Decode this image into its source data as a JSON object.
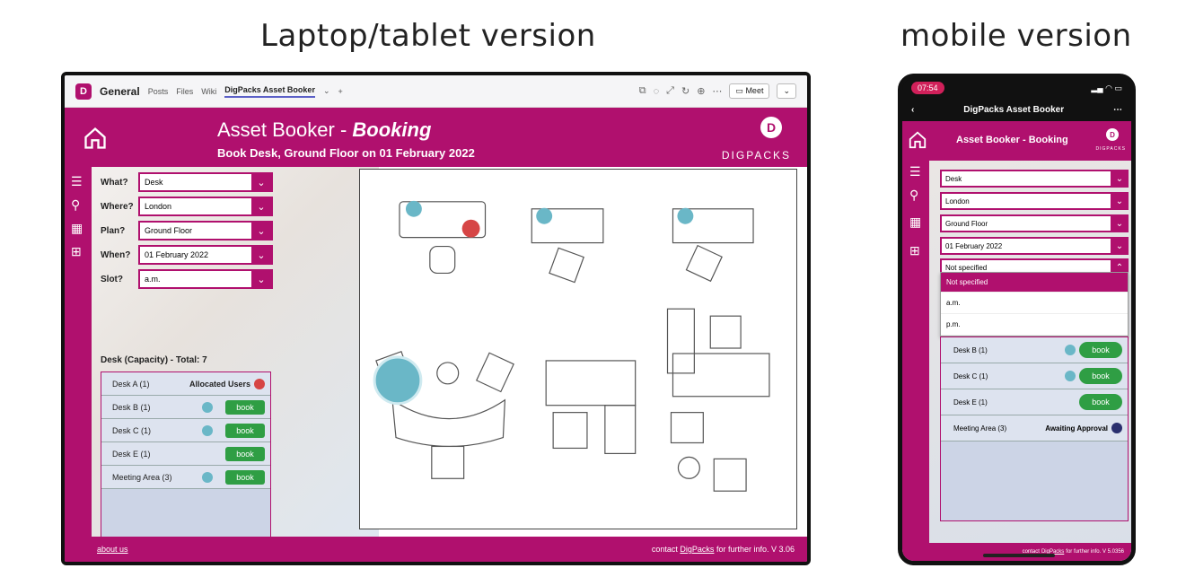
{
  "headings": {
    "laptop": "Laptop/tablet version",
    "mobile": "mobile version"
  },
  "teams": {
    "channel": "General",
    "tabs": [
      "Posts",
      "Files",
      "Wiki",
      "DigPacks Asset Booker"
    ],
    "meet_label": "Meet"
  },
  "app": {
    "title_main": "Asset Booker - ",
    "title_em": "Booking",
    "subtitle": "Book Desk, Ground Floor on 01 February 2022",
    "logo_text": "DIGPACKS",
    "filters": [
      {
        "label": "What?",
        "value": "Desk"
      },
      {
        "label": "Where?",
        "value": "London"
      },
      {
        "label": "Plan?",
        "value": "Ground Floor"
      },
      {
        "label": "When?",
        "value": "01 February 2022"
      },
      {
        "label": "Slot?",
        "value": "a.m."
      }
    ],
    "total_line": "Desk (Capacity) - Total: 7",
    "desks": [
      {
        "name": "Desk A (1)",
        "status": "Allocated Users"
      },
      {
        "name": "Desk B (1)",
        "action": "book"
      },
      {
        "name": "Desk C (1)",
        "action": "book"
      },
      {
        "name": "Desk E (1)",
        "action": "book"
      },
      {
        "name": "Meeting Area (3)",
        "action": "book"
      }
    ],
    "footer": {
      "about": "about us",
      "contact_pre": "contact ",
      "contact_link": "DigPacks",
      "contact_post": " for further info. V 3.06"
    }
  },
  "mobile": {
    "time": "07:54",
    "nav_title": "DigPacks Asset Booker",
    "app_title": "Asset Booker - Booking",
    "logo_text": "DIGPACKS",
    "filters": [
      "Desk",
      "London",
      "Ground Floor",
      "01 February 2022",
      "Not specified"
    ],
    "dropdown_options": [
      "Not specified",
      "a.m.",
      "p.m."
    ],
    "desks": [
      {
        "name": "Desk B (1)",
        "action": "book"
      },
      {
        "name": "Desk C (1)",
        "action": "book"
      },
      {
        "name": "Desk E (1)",
        "action": "book"
      },
      {
        "name": "Meeting Area (3)",
        "status": "Awaiting Approval"
      }
    ],
    "footer": {
      "contact_pre": "contact ",
      "contact_link": "DigPacks",
      "contact_post": " for further info. V 5.0356"
    }
  },
  "colors": {
    "brand": "#b0106e",
    "book": "#2f9e44"
  }
}
